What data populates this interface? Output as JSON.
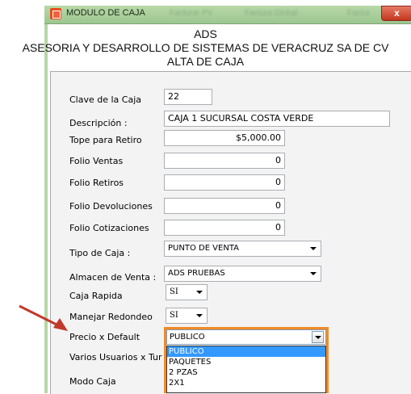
{
  "window": {
    "title": "MODULO DE CAJA",
    "blurred_tabs": [
      "Facturar PV",
      "Factura Global",
      "Factur"
    ],
    "close_label": "x"
  },
  "header": {
    "line1": "ADS",
    "line2": "ASESORIA Y DESARROLLO DE SISTEMAS DE VERACRUZ SA DE CV",
    "line3": "ALTA DE CAJA"
  },
  "form": {
    "clave": {
      "label": "Clave de la Caja",
      "value": "22"
    },
    "descripcion": {
      "label": "Descripción :",
      "value": "CAJA 1 SUCURSAL COSTA VERDE"
    },
    "tope": {
      "label": "Tope para Retiro",
      "value": "$5,000.00"
    },
    "folio_ventas": {
      "label": "Folio Ventas",
      "value": "0"
    },
    "folio_retiros": {
      "label": "Folio Retiros",
      "value": "0"
    },
    "folio_devoluciones": {
      "label": "Folio Devoluciones",
      "value": "0"
    },
    "folio_cotizaciones": {
      "label": "Folio Cotizaciones",
      "value": "0"
    },
    "tipo_caja": {
      "label": "Tipo de Caja :",
      "value": "PUNTO DE VENTA"
    },
    "almacen": {
      "label": "Almacen de Venta :",
      "value": "ADS PRUEBAS"
    },
    "caja_rapida": {
      "label": "Caja Rapida",
      "value": "SI"
    },
    "redondeo": {
      "label": "Manejar Redondeo",
      "value": "SI"
    },
    "precio_default": {
      "label": "Precio x Default",
      "value": "PUBLICO",
      "options": [
        "PUBLICO",
        "PAQUETES",
        "2 PZAS",
        "2X1"
      ],
      "highlight_color": "#f28a26"
    },
    "varios_usuarios": {
      "label": "Varios Usuarios x Tur"
    },
    "modo_caja": {
      "label": "Modo Caja"
    }
  },
  "annotation": {
    "arrow_color": "#c0392b"
  }
}
